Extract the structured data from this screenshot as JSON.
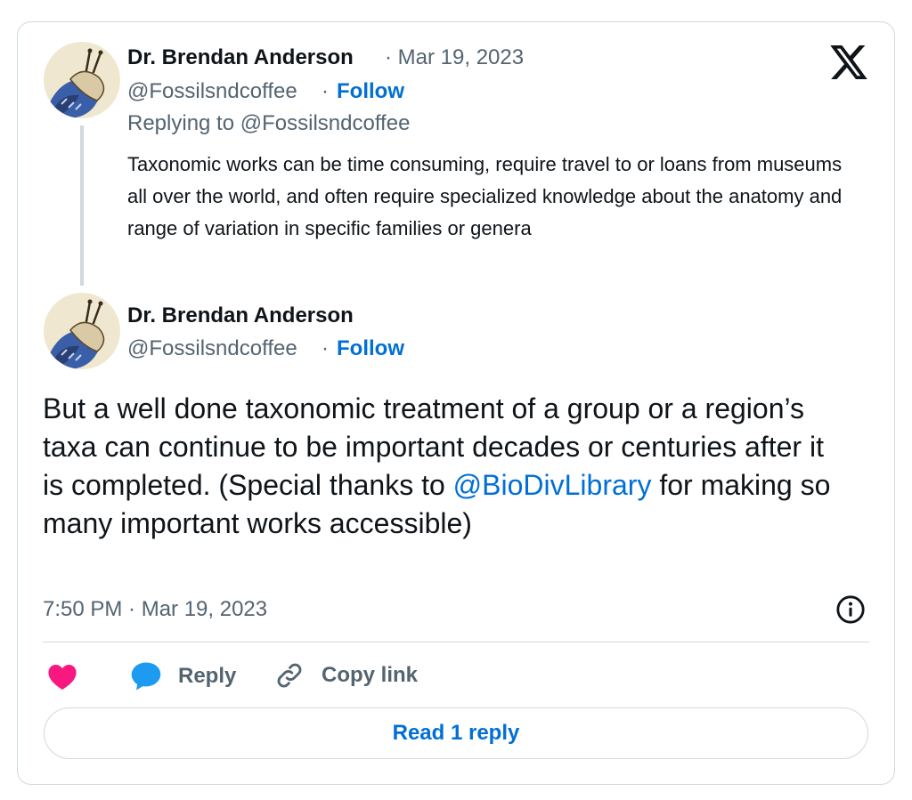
{
  "colors": {
    "accent": "#006fd6",
    "muted": "#536471",
    "text": "#0f1419",
    "border": "#cfd9de",
    "like": "#f91880",
    "reply_icon": "#1d9bf0"
  },
  "header": {
    "logo_icon": "x-logo-icon"
  },
  "reply_tweet": {
    "author_name": "Dr. Brendan Anderson",
    "date": "· Mar 19, 2023",
    "handle": "@Fossilsndcoffee",
    "separator": "·",
    "follow_label": "Follow",
    "replying_to": "Replying to @Fossilsndcoffee",
    "text": "Taxonomic works can be time consuming, require travel to or loans from museums all over the world, and often require specialized knowledge about the anatomy and range of variation in specific families or genera"
  },
  "main_tweet": {
    "author_name": "Dr. Brendan Anderson",
    "handle": "@Fossilsndcoffee",
    "separator": "·",
    "follow_label": "Follow",
    "text_before": "But a well done taxonomic treatment of a group or a region’s taxa can continue to be important decades or centuries after it is completed. (Special thanks to ",
    "mention": "@BioDivLibrary",
    "text_after": " for making so many important works accessible)",
    "timestamp": "7:50 PM · Mar 19, 2023"
  },
  "actions": {
    "like_icon": "heart-icon",
    "reply_label": "Reply",
    "copy_label": "Copy link"
  },
  "footer": {
    "read_replies_label": "Read 1 reply"
  }
}
